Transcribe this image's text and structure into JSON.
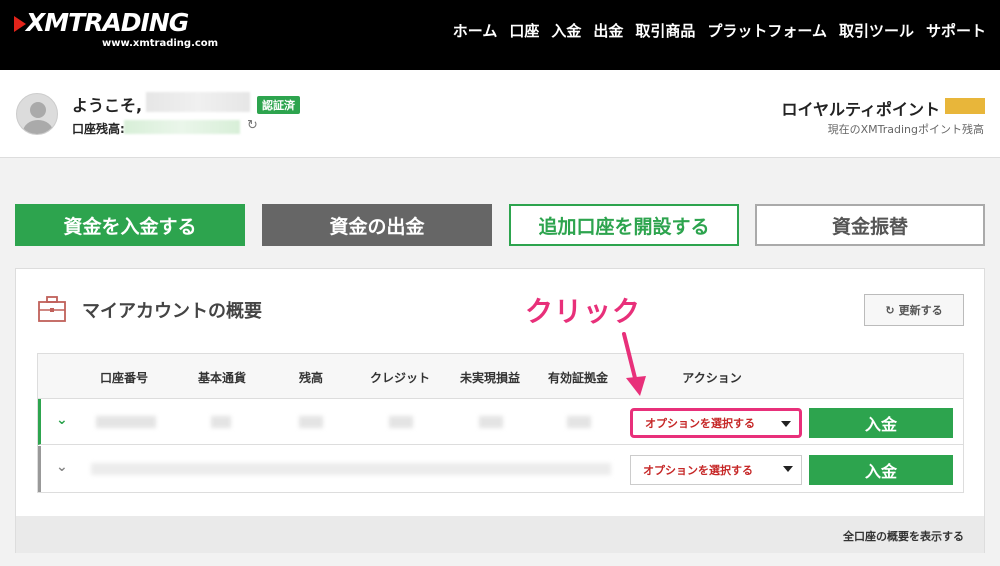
{
  "brand": {
    "logo_text": "XMTRADING",
    "logo_sub": "www.xmtrading.com"
  },
  "nav": [
    "ホーム",
    "口座",
    "入金",
    "出金",
    "取引商品",
    "プラットフォーム",
    "取引ツール",
    "サポート"
  ],
  "welcome": {
    "greeting": "ようこそ,",
    "verified_badge": "認証済",
    "balance_label": "口座残高:",
    "refresh_icon": "↻"
  },
  "loyalty": {
    "title": "ロイヤルティポイント",
    "subtitle": "現在のXMTradingポイント残高"
  },
  "actions": {
    "deposit": "資金を入金する",
    "withdraw": "資金の出金",
    "open_account": "追加口座を開設する",
    "transfer": "資金振替"
  },
  "panel": {
    "title": "マイアカウントの概要",
    "refresh_label": "更新する",
    "footer_link": "全口座の概要を表示する"
  },
  "annotation": {
    "text": "クリック"
  },
  "table": {
    "headers": [
      "口座番号",
      "基本通貨",
      "残高",
      "クレジット",
      "未実現損益",
      "有効証拠金",
      "アクション"
    ],
    "rows": [
      {
        "select_label": "オプションを選択する",
        "deposit_label": "入金"
      },
      {
        "select_label": "オプションを選択する",
        "deposit_label": "入金"
      }
    ]
  },
  "colors": {
    "green": "#2da44e",
    "pink": "#e8307a",
    "red_text": "#c62828",
    "gold": "#e8b63a"
  }
}
